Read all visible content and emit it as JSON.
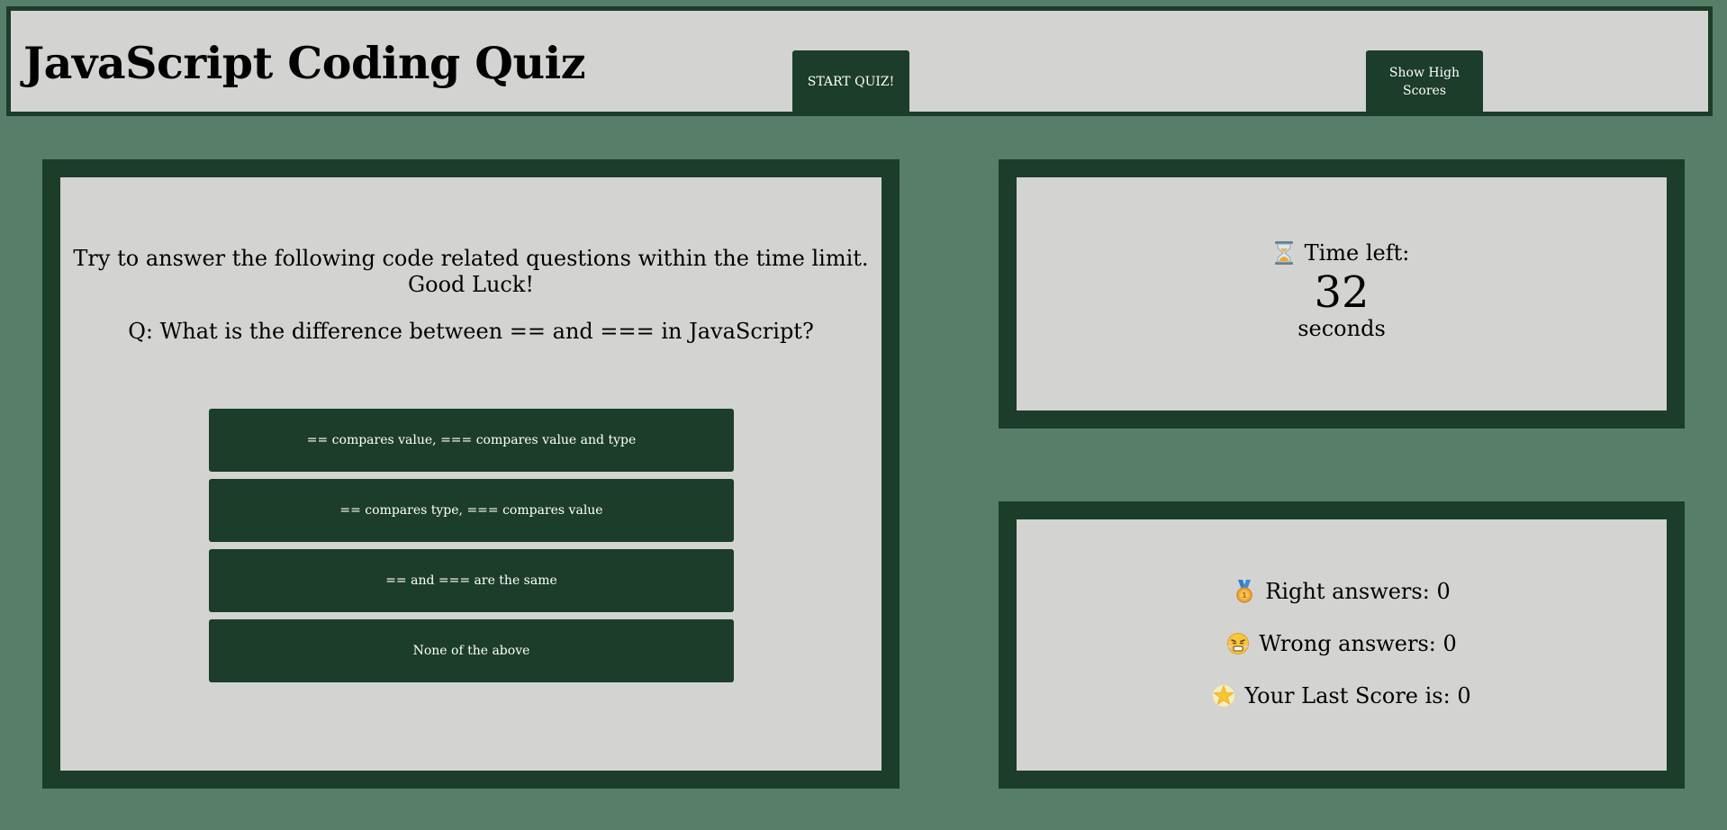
{
  "header": {
    "title": "JavaScript Coding Quiz",
    "start_button": "START QUIZ!",
    "scores_button": "Show High Scores"
  },
  "quiz": {
    "intro_line1": "Try to answer the following code related questions within the time limit.",
    "intro_line2": "Good Luck!",
    "question": "Q: What is the difference between == and === in JavaScript?",
    "answers": [
      "== compares value, === compares value and type",
      "== compares type, === compares value",
      "== and === are the same",
      "None of the above"
    ]
  },
  "timer": {
    "icon": "hourglass-icon",
    "label": "Time left:",
    "value": "32",
    "unit": "seconds"
  },
  "scores": {
    "right_icon": "medal-icon",
    "right_label": "Right answers: 0",
    "wrong_icon": "frustrated-face-icon",
    "wrong_label": "Wrong answers: 0",
    "last_icon": "glowing-star-icon",
    "last_label": "Your Last Score is: 0"
  },
  "colors": {
    "background": "#567e69",
    "panel_border": "#1b3d2a",
    "panel_fill": "#d3d3d1",
    "button": "#1b3d2a",
    "button_text": "#ffffff"
  }
}
